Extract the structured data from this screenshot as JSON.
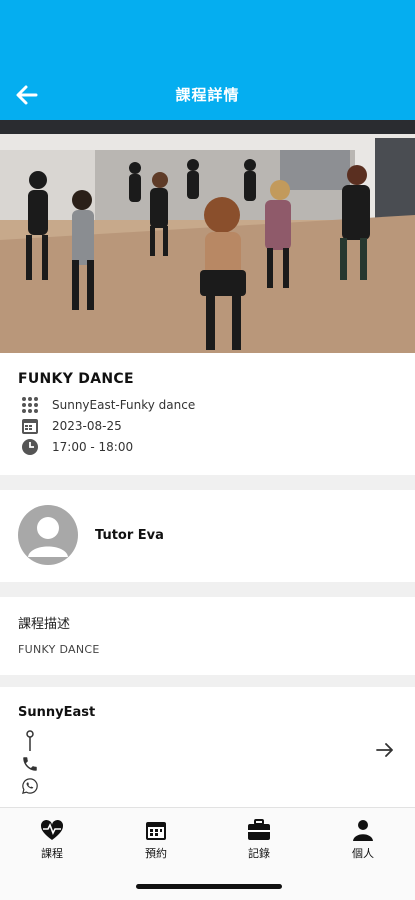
{
  "header": {
    "title": "課程詳情",
    "back_icon": "arrow-left-icon"
  },
  "hero": {
    "description_icon": "dance-class-photo"
  },
  "course": {
    "title": "FUNKY DANCE",
    "location": "SunnyEast-Funky dance",
    "date": "2023-08-25",
    "time": "17:00 - 18:00"
  },
  "tutor": {
    "name": "Tutor Eva"
  },
  "description": {
    "label": "課程描述",
    "text": "FUNKY DANCE"
  },
  "venue": {
    "name": "SunnyEast"
  },
  "tabs": [
    {
      "label": "課程",
      "icon": "heart-pulse-icon"
    },
    {
      "label": "預約",
      "icon": "calendar-icon"
    },
    {
      "label": "記錄",
      "icon": "briefcase-icon"
    },
    {
      "label": "個人",
      "icon": "person-icon"
    }
  ],
  "colors": {
    "header": "#05aef0",
    "background": "#f0f0f0",
    "icon_gray": "#555555"
  }
}
